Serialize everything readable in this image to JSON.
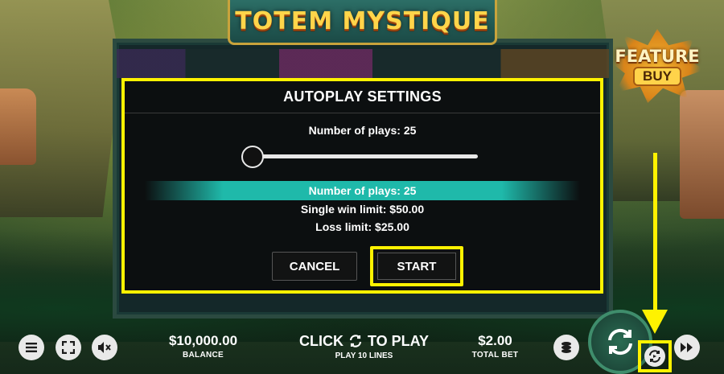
{
  "game": {
    "title": "TOTEM MYSTIQUE",
    "feature_buy": {
      "top": "FEATURE",
      "bottom": "BUY"
    }
  },
  "dialog": {
    "title": "AUTOPLAY SETTINGS",
    "plays_label": "Number of plays:",
    "plays_value": "25",
    "slider_fraction": 0.0,
    "summary": {
      "plays": "Number of plays:  25",
      "single_win_limit": "Single win limit:  $50.00",
      "loss_limit": "Loss limit:  $25.00"
    },
    "cancel_label": "CANCEL",
    "start_label": "START"
  },
  "bottom_bar": {
    "balance_value": "$10,000.00",
    "balance_label": "BALANCE",
    "click_text": "CLICK",
    "to_play_text": "TO PLAY",
    "play_lines": "PLAY 10 LINES",
    "total_bet_value": "$2.00",
    "total_bet_label": "TOTAL BET"
  },
  "icons": {
    "menu": "menu-icon",
    "fullscreen": "fullscreen-icon",
    "mute": "mute-icon",
    "coins": "coins-icon",
    "spin": "spin-icon",
    "autoplay": "autoplay-icon",
    "turbo": "fast-forward-icon"
  },
  "colors": {
    "highlight": "#fff200",
    "summary_bar": "#1fb9aa",
    "logo_gold": "#ffd54a"
  }
}
